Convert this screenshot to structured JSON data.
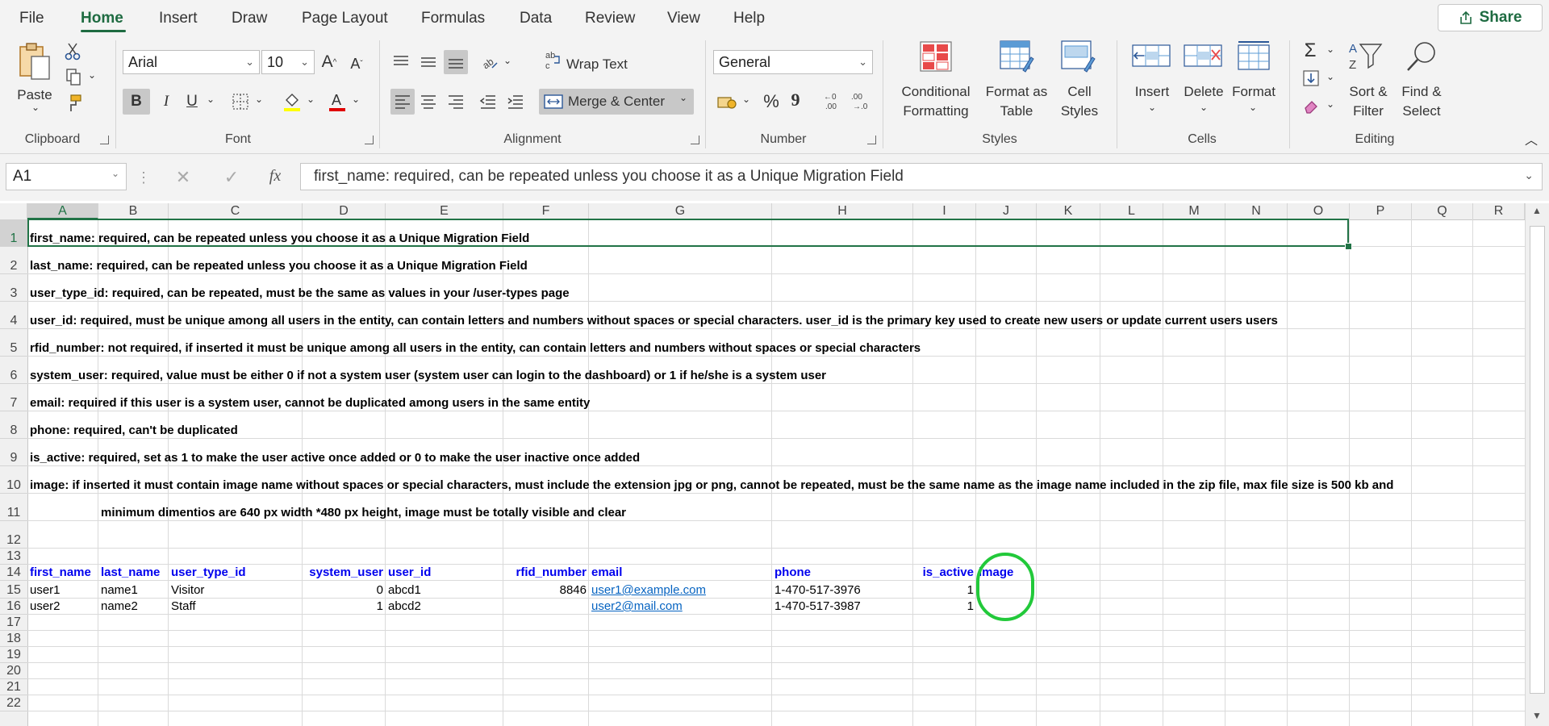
{
  "menu": {
    "tabs": [
      "File",
      "Home",
      "Insert",
      "Draw",
      "Page Layout",
      "Formulas",
      "Data",
      "Review",
      "View",
      "Help"
    ],
    "active_tab": "Home",
    "share_label": "Share"
  },
  "ribbon": {
    "clipboard": {
      "paste_label": "Paste",
      "group_label": "Clipboard"
    },
    "font": {
      "font_name": "Arial",
      "font_size": "10",
      "group_label": "Font",
      "bold": "B",
      "italic": "I",
      "underline": "U"
    },
    "alignment": {
      "wrap_text": "Wrap Text",
      "merge_center": "Merge & Center",
      "group_label": "Alignment"
    },
    "number": {
      "format": "General",
      "group_label": "Number",
      "percent": "%",
      "comma": "9"
    },
    "styles": {
      "conditional_1": "Conditional",
      "conditional_2": "Formatting",
      "format_table_1": "Format as",
      "format_table_2": "Table",
      "cell_styles_1": "Cell",
      "cell_styles_2": "Styles",
      "group_label": "Styles"
    },
    "cells": {
      "insert": "Insert",
      "delete": "Delete",
      "format": "Format",
      "group_label": "Cells"
    },
    "editing": {
      "sort_1": "Sort &",
      "sort_2": "Filter",
      "find_1": "Find &",
      "find_2": "Select",
      "group_label": "Editing"
    }
  },
  "formula_bar": {
    "name_box": "A1",
    "fx": "fx",
    "content": "first_name: required, can be repeated unless you choose it as a Unique Migration Field"
  },
  "columns": [
    "A",
    "B",
    "C",
    "D",
    "E",
    "F",
    "G",
    "H",
    "I",
    "J",
    "K",
    "L",
    "M",
    "N",
    "O",
    "P",
    "Q",
    "R"
  ],
  "rows": [
    "1",
    "2",
    "3",
    "4",
    "5",
    "6",
    "7",
    "8",
    "9",
    "10",
    "11",
    "12",
    "13",
    "14",
    "15",
    "16",
    "17",
    "18",
    "19",
    "20",
    "21",
    "22"
  ],
  "notes": [
    "first_name: required, can be repeated unless you choose it as a Unique Migration Field",
    "last_name: required, can be repeated unless you choose it as a Unique Migration Field",
    "user_type_id: required, can be repeated, must be the same as values in your /user-types page",
    "user_id: required, must be unique among all users in the entity, can contain letters and numbers without spaces or special characters. user_id is the primary key used to create new users or update current users users",
    "rfid_number: not required, if inserted it must be unique among all users in the entity, can contain letters and numbers without spaces or special characters",
    "system_user: required, value must be either 0 if not a system user (system user can login to the dashboard) or 1 if he/she is a system user",
    "email: required if this user is a system user, cannot be duplicated among users in the same entity",
    "phone: required, can't be duplicated",
    "is_active: required, set as 1 to make the user active once added or 0 to make the user inactive once added",
    "image: if inserted it must contain image name without spaces or special characters, must include the extension jpg or png, cannot be repeated, must be the same name as the image name included in the zip file, max file size is 500 kb and",
    "minimum dimentios are 640 px width *480 px height, image must be totally visible and clear"
  ],
  "table": {
    "headers": [
      "first_name",
      "last_name",
      "user_type_id",
      "system_user",
      "user_id",
      "rfid_number",
      "email",
      "phone",
      "is_active",
      "image"
    ],
    "rows": [
      [
        "user1",
        "name1",
        "Visitor",
        "0",
        "abcd1",
        "8846",
        "user1@example.com",
        "1-470-517-3976",
        "1",
        ""
      ],
      [
        "user2",
        "name2",
        "Staff",
        "1",
        "abcd2",
        "",
        "user2@mail.com",
        "1-470-517-3987",
        "1",
        ""
      ]
    ]
  },
  "colors": {
    "accent": "#217346",
    "highlight_circle": "#22c93a",
    "header_text": "#0000ee",
    "link": "#0563c1"
  }
}
